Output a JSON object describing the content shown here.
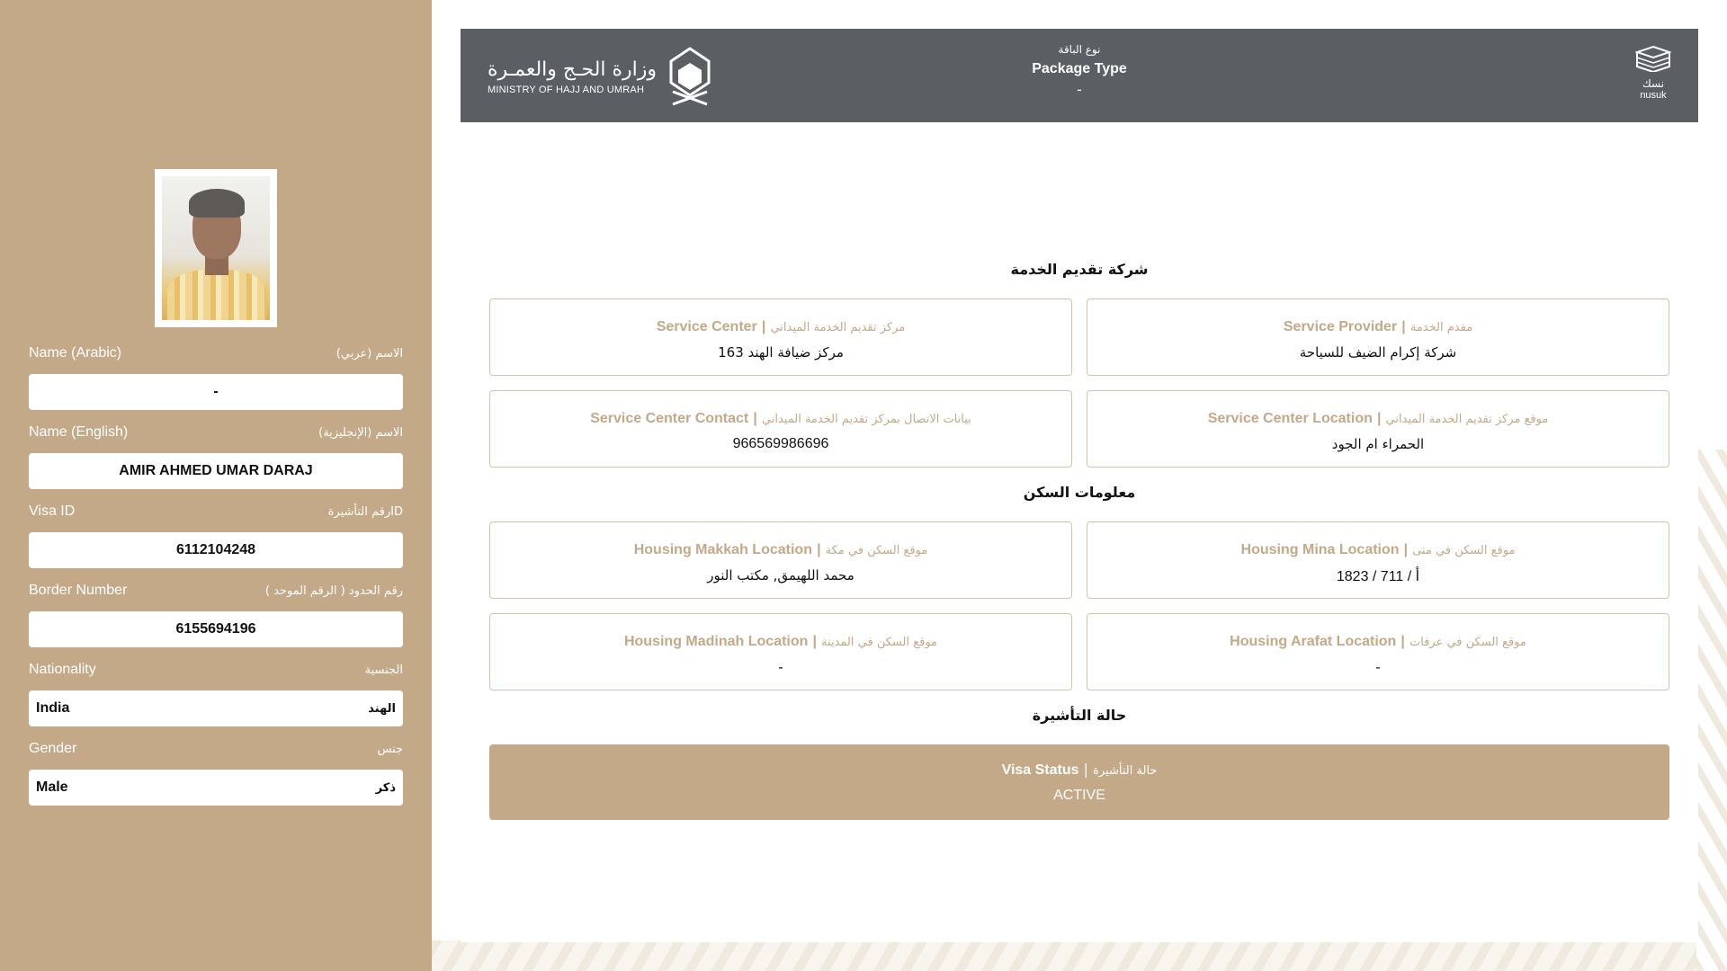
{
  "sidebar": {
    "fields": [
      {
        "label_en": "Name (Arabic)",
        "label_ar": "الاسم (عربي)",
        "value": "-"
      },
      {
        "label_en": "Name (English)",
        "label_ar": "الاسم (الإنجليزية)",
        "value": "AMIR AHMED UMAR DARAJ"
      },
      {
        "label_en": "Visa ID",
        "label_ar": "رقم التأشيرةID",
        "value": "6112104248"
      },
      {
        "label_en": "Border Number",
        "label_ar": "رقم الحدود ( الرقم الموحد )",
        "value": "6155694196"
      },
      {
        "label_en": "Nationality",
        "label_ar": "الجنسية",
        "value_en": "India",
        "value_ar": "الهند"
      },
      {
        "label_en": "Gender",
        "label_ar": "جنس",
        "value_en": "Male",
        "value_ar": "ذكر"
      }
    ]
  },
  "header": {
    "ministry_ar": "وزارة الحـج والعمـرة",
    "ministry_en": "MINISTRY OF HAJJ AND UMRAH",
    "package_ar": "نوع الباقة",
    "package_en": "Package Type",
    "package_value": "-",
    "nusuk_ar": "نسك",
    "nusuk_en": "nusuk"
  },
  "sections": {
    "service_title": "شركة تقديم الخدمة",
    "housing_title": "معلومات السكن",
    "visa_title": "حالة التأشيرة"
  },
  "cards": {
    "service_provider": {
      "en": "Service Provider",
      "ar": "مقدم الخدمة",
      "value": "شركة إكرام الضيف للسياحة"
    },
    "service_center": {
      "en": "Service Center",
      "ar": "مركز تقديم الخدمة الميداني",
      "value": "مركز ضيافة الهند 163"
    },
    "service_center_location": {
      "en": "Service Center Location",
      "ar": "موقع مركز تقديم الخدمة الميداني",
      "value": "الحمراء ام الجود"
    },
    "service_center_contact": {
      "en": "Service Center Contact",
      "ar": "بيانات الاتصال بمركز تقديم الخدمة الميداني",
      "value": "966569986696"
    },
    "housing_mina": {
      "en": "Housing Mina Location",
      "ar": "موقع السكن في منى",
      "value": "1823 / 711 / أ"
    },
    "housing_makkah": {
      "en": "Housing Makkah Location",
      "ar": "موقع السكن في مكة",
      "value": "محمد اللهيمق, مكتب النور"
    },
    "housing_arafat": {
      "en": "Housing Arafat Location",
      "ar": "موقع السكن في عرفات",
      "value": "-"
    },
    "housing_madinah": {
      "en": "Housing Madinah Location",
      "ar": "موقع السكن في المدينة",
      "value": "-"
    },
    "visa_status": {
      "en": "Visa Status",
      "ar": "حالة التأشيرة",
      "value": "ACTIVE"
    }
  },
  "colors": {
    "sidebar": "#c4a988",
    "header": "#5b5e62",
    "card_border": "#d4c2a9",
    "accent_text": "#c4a988"
  }
}
